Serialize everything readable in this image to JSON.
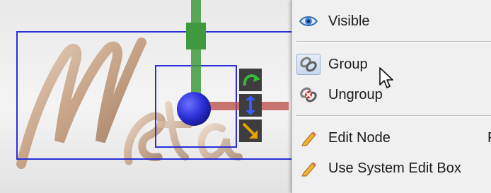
{
  "viewport": {
    "scene_text": "Meta",
    "gizmo_icons": [
      "rotate-arrow-icon",
      "move-vertical-arrow-icon",
      "scale-arrow-icon"
    ]
  },
  "context_menu": {
    "visible_label": "Visible",
    "group_label": "Group",
    "ungroup_label": "Ungroup",
    "edit_node_label": "Edit Node",
    "edit_node_shortcut": "F",
    "use_system_edit_box_label": "Use System Edit Box"
  },
  "icons": {
    "visible": "eye-icon",
    "group": "group-chain-icon",
    "ungroup": "ungroup-chain-icon",
    "edit_node": "pencil-icon",
    "use_system_edit_box": "pencil-icon",
    "cursor": "mouse-pointer-icon"
  },
  "colors": {
    "selection_box": "#2a2fd8",
    "gizmo_green": "#3f9a3f",
    "gizmo_blue": "#2b2fd6",
    "gizmo_red": "#b84a44",
    "text_bronze": "#c9a98b",
    "menu_bg": "#f0f0f0"
  }
}
